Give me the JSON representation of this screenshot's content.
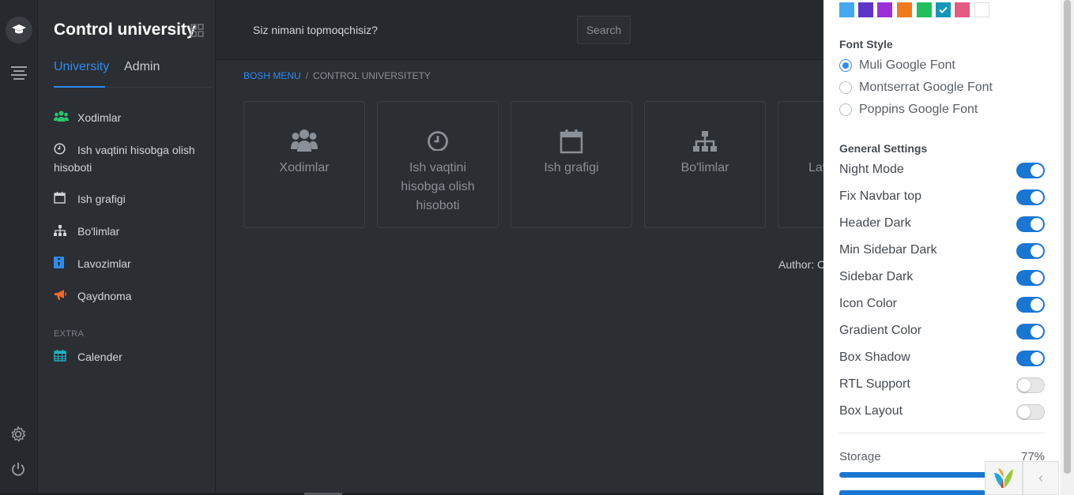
{
  "app": {
    "title": "Control university"
  },
  "sidebar": {
    "tabs": [
      "University",
      "Admin"
    ],
    "items": [
      {
        "label": "Xodimlar",
        "icon": "users-icon",
        "color": "#28c76f"
      },
      {
        "label": "Ish vaqtini hisobga olish hisoboti",
        "icon": "clock-icon",
        "color": "#d2d5da"
      },
      {
        "label": "Ish grafigi",
        "icon": "calendar-icon",
        "color": "#d2d5da"
      },
      {
        "label": "Bo'limlar",
        "icon": "sitemap-icon",
        "color": "#d2d5da"
      },
      {
        "label": "Lavozimlar",
        "icon": "id-badge-icon",
        "color": "#2d8cf0"
      },
      {
        "label": "Qaydnoma",
        "icon": "megaphone-icon",
        "color": "#f26722"
      }
    ],
    "extra_label": "EXTRA",
    "extra_items": [
      {
        "label": "Calender",
        "icon": "calendar-grid-icon",
        "color": "#1fb5c4"
      }
    ]
  },
  "header": {
    "search_placeholder": "Siz nimani topmoqchisiz?",
    "search_button": "Search"
  },
  "breadcrumb": {
    "home": "BOSH MENU",
    "separator": "/",
    "current": "CONTROL UNIVERSITETY"
  },
  "cards": [
    {
      "label": "Xodimlar",
      "icon": "users-icon"
    },
    {
      "label": "Ish vaqtini hisobga olish hisoboti",
      "icon": "clock-icon"
    },
    {
      "label": "Ish grafigi",
      "icon": "calendar-icon"
    },
    {
      "label": "Bo'limlar",
      "icon": "sitemap-icon"
    },
    {
      "label": "Lav",
      "icon": "id-badge-icon"
    }
  ],
  "footer": {
    "author": "Author: C"
  },
  "settings": {
    "swatches": [
      {
        "color": "#43a9f0",
        "checked": false
      },
      {
        "color": "#5c35c9",
        "checked": false
      },
      {
        "color": "#9b30d9",
        "checked": false
      },
      {
        "color": "#f07a1f",
        "checked": false
      },
      {
        "color": "#1fc05a",
        "checked": false
      },
      {
        "color": "#1497b8",
        "checked": true
      },
      {
        "color": "#e35a82",
        "checked": false
      },
      {
        "color": "#ffffff",
        "checked": false
      }
    ],
    "font_style_title": "Font Style",
    "fonts": [
      {
        "label": "Muli Google Font",
        "selected": true
      },
      {
        "label": "Montserrat Google Font",
        "selected": false
      },
      {
        "label": "Poppins Google Font",
        "selected": false
      }
    ],
    "general_title": "General Settings",
    "toggles": [
      {
        "label": "Night Mode",
        "on": true
      },
      {
        "label": "Fix Navbar top",
        "on": true
      },
      {
        "label": "Header Dark",
        "on": true
      },
      {
        "label": "Min Sidebar Dark",
        "on": true
      },
      {
        "label": "Sidebar Dark",
        "on": true
      },
      {
        "label": "Icon Color",
        "on": true
      },
      {
        "label": "Gradient Color",
        "on": true
      },
      {
        "label": "Box Shadow",
        "on": true
      },
      {
        "label": "RTL Support",
        "on": false
      },
      {
        "label": "Box Layout",
        "on": false
      }
    ],
    "storage_label": "Storage",
    "storage_percent": "77%",
    "storage_fraction": 0.77
  }
}
